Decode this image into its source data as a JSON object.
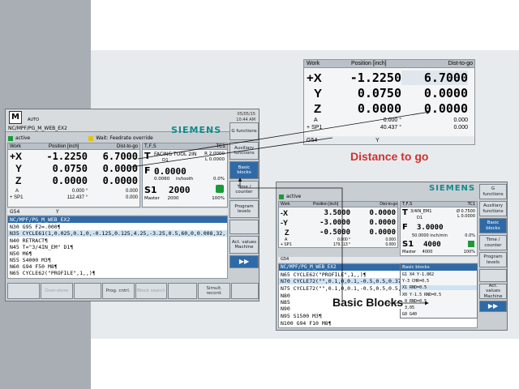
{
  "colors": {
    "accent": "#2e6aa8",
    "brand": "#0f8c8c",
    "callout_red": "#d23030"
  },
  "callouts": {
    "distance_to_go": "Distance to go",
    "basic_blocks": "Basic Blocks"
  },
  "main": {
    "date": "05/05/15",
    "time": "10:44 AM",
    "mode_label": "AUTO",
    "program_path": "NC/MPF/PG_M_WEB_EX2",
    "brand": "SIEMENS",
    "status": "active",
    "wait_msg": "Wait: Feedrate override",
    "axis_headers": {
      "work": "Work",
      "position": "Position [inch]",
      "dtg": "Dist-to-go"
    },
    "axes": [
      {
        "sign": "+",
        "name": "X",
        "pos": "-1.2250",
        "dtg": "6.7000"
      },
      {
        "sign": "",
        "name": "Y",
        "pos": "0.0750",
        "dtg": "0.0000"
      },
      {
        "sign": "",
        "name": "Z",
        "pos": "0.0000",
        "dtg": "0.0000"
      }
    ],
    "aux_axes": [
      {
        "name": "A",
        "pos": "0.000 °",
        "dtg": "0.000"
      },
      {
        "name": "+ SP1",
        "pos": "112.437 °",
        "dtg": "0.000"
      }
    ],
    "tfs": {
      "header": "T,F,S",
      "tc": "TC1",
      "tool": "FACING TOOL 2IN",
      "d": "D1",
      "tool_r": "R 2.0000",
      "tool_l": "L 0.0000",
      "f_value": "0.0000",
      "f_sub": "0.0060",
      "f_unit": "in/tooth",
      "f_pct": "0.0%",
      "s_label": "S1",
      "s_value": "2000",
      "master": "Master",
      "master_val": "2000",
      "s_pct": "100%"
    },
    "wcs": "G54",
    "frame": "Y",
    "program_lines": [
      "NC/MPF/PG_M_WEB_EX2",
      "N30 G95 F2=.000¶",
      "N35 CYCLE61(1,0.025,0.1,0,-0.125,0.125,4.25,-3.25,0.5,60,0,0.008,32,",
      "N40 RETRACT¶",
      "N45 T=\"3/4IN_EM\" D1¶",
      "N50 M6¶",
      "N55 S4000 M3¶",
      "N60 G94 F50 M8¶",
      "N65 CYCLE62(\"PROFILE\",1,,)¶"
    ],
    "softkeys": [
      "G functions",
      "Auxiliary functions",
      "Basic blocks",
      "Time / counter",
      "Program levels",
      "",
      "Act. values Machine",
      "▶▶"
    ],
    "bottom_keys": [
      "",
      "Over-store",
      "",
      "Prog. cntrl.",
      "Block search",
      "",
      "Simult. record."
    ]
  },
  "dtg_panel": {
    "headers": {
      "work": "Work",
      "position": "Position [inch]",
      "dtg": "Dist-to-go"
    },
    "axes": [
      {
        "sign": "+",
        "name": "X",
        "pos": "-1.2250",
        "dtg": "6.7000"
      },
      {
        "sign": "",
        "name": "Y",
        "pos": "0.0750",
        "dtg": "0.0000"
      },
      {
        "sign": "",
        "name": "Z",
        "pos": "0.0000",
        "dtg": "0.0000"
      }
    ],
    "aux_axes": [
      {
        "name": "A",
        "pos": "0.000 °",
        "dtg": "0.000"
      },
      {
        "name": "+ SP1",
        "pos": "40.437 °",
        "dtg": "0.000"
      }
    ],
    "wcs": "G54",
    "frame": "Y"
  },
  "second": {
    "brand": "SIEMENS",
    "status": "active",
    "axis_headers": {
      "work": "Work",
      "position": "Position [inch]",
      "dtg": "Dist-to-go"
    },
    "axes": [
      {
        "sign": "-",
        "name": "X",
        "pos": "3.5000",
        "dtg": "0.0000"
      },
      {
        "sign": "-",
        "name": "Y",
        "pos": "-3.0000",
        "dtg": "0.0000"
      },
      {
        "sign": "",
        "name": "Z",
        "pos": "-0.5000",
        "dtg": "0.0000"
      }
    ],
    "aux_axes": [
      {
        "name": "A",
        "pos": "0.000 °",
        "dtg": "0.000"
      },
      {
        "name": "+ SP1",
        "pos": "179.113 °",
        "dtg": "0.000"
      }
    ],
    "tfs": {
      "header": "T,F,S",
      "tc": "TC1",
      "tool": "3/4IN_EM1",
      "d": "D1",
      "tool_r": "Ø 0.7500",
      "tool_l": "L 0.0000",
      "f_value": "3.0000",
      "f_sub": "50.0000",
      "f_unit": "inch/min",
      "f_pct": "0.0%",
      "s_label": "S1",
      "s_value": "4000",
      "master": "Master",
      "master_val": "4000",
      "s_pct": "100%"
    },
    "wcs": "G54",
    "program_path": "NC/MPF/PG_M_WEB_EX2",
    "program_lines": [
      "N65 CYCLE62(\"PROFILE\",1,,)¶",
      "N70 CYCLE72(\"\",0.1,0,0.1,-0.5,0.5,0.375,0",
      "N75 CYCLE72(\"\",0.1,0,0.1,-0.5,0.5,0.5,0.",
      "N80",
      "N85",
      "N90",
      "N95 S1500 M3¶",
      "N100 G94 F10 M8¶"
    ],
    "basic_blocks": {
      "title": "Basic blocks",
      "lines": [
        "G1 X4 Y-1.862",
        "Y-3 CHR=0.5",
        "X1 RND=0.5",
        "X0 Y-1.5 RND=0.5",
        "Y0 RND=0.5",
        "X3.05",
        "G0 G40"
      ]
    },
    "softkeys": [
      "G functions",
      "Auxiliary functions",
      "Basic blocks",
      "Time / counter",
      "Program levels",
      "",
      "Act. values Machine",
      "▶▶"
    ]
  }
}
